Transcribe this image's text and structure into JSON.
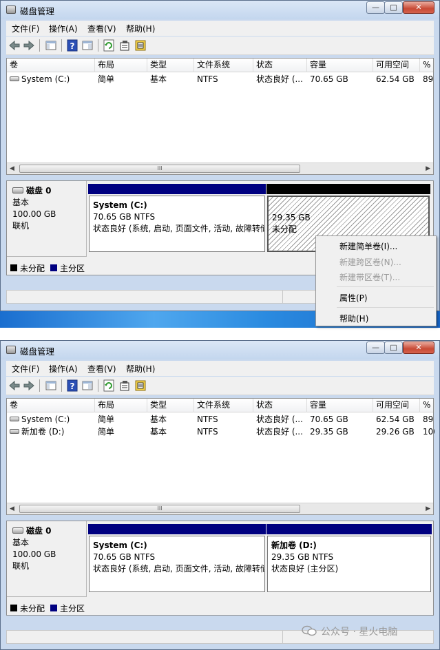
{
  "title": "磁盘管理",
  "window_controls": {
    "minimize": "—",
    "maximize": "□",
    "close": "✕"
  },
  "menu": [
    "文件(F)",
    "操作(A)",
    "查看(V)",
    "帮助(H)"
  ],
  "toolbar_icons": [
    "back-arrow-icon",
    "forward-arrow-icon",
    "console-tree-icon",
    "help-icon",
    "action-pane-icon",
    "refresh-icon",
    "properties-icon",
    "disk-settings-icon"
  ],
  "columns": [
    "卷",
    "布局",
    "类型",
    "文件系统",
    "状态",
    "容量",
    "可用空间",
    "%"
  ],
  "volumes_before": [
    {
      "name": "System (C:)",
      "layout": "简单",
      "type": "基本",
      "fs": "NTFS",
      "status": "状态良好 (...",
      "capacity": "70.65 GB",
      "free": "62.54 GB",
      "pct": "89"
    }
  ],
  "volumes_after": [
    {
      "name": "System (C:)",
      "layout": "简单",
      "type": "基本",
      "fs": "NTFS",
      "status": "状态良好 (...",
      "capacity": "70.65 GB",
      "free": "62.54 GB",
      "pct": "89"
    },
    {
      "name": "新加卷 (D:)",
      "layout": "简单",
      "type": "基本",
      "fs": "NTFS",
      "status": "状态良好 (...",
      "capacity": "29.35 GB",
      "free": "29.26 GB",
      "pct": "100"
    }
  ],
  "disk": {
    "name": "磁盘 0",
    "type": "基本",
    "size": "100.00 GB",
    "state": "联机"
  },
  "partition_c": {
    "name": "System  (C:)",
    "size": "70.65 GB NTFS",
    "status": "状态良好 (系统, 启动, 页面文件, 活动, 故障转储"
  },
  "partition_unalloc": {
    "size": "29.35 GB",
    "status": "未分配"
  },
  "partition_d": {
    "name": "新加卷  (D:)",
    "size": "29.35 GB NTFS",
    "status": "状态良好 (主分区)"
  },
  "legend": {
    "unallocated": "未分配",
    "primary": "主分区"
  },
  "colors": {
    "primary": "#000080",
    "unallocated": "#000000",
    "titlebar": "#c9d9ee"
  },
  "context_menu": [
    {
      "label": "新建简单卷(I)...",
      "enabled": true
    },
    {
      "label": "新建跨区卷(N)...",
      "enabled": false
    },
    {
      "label": "新建带区卷(T)...",
      "enabled": false
    },
    {
      "label": "属性(P)",
      "enabled": true
    },
    {
      "label": "帮助(H)",
      "enabled": true
    }
  ],
  "scroll_grip": "III",
  "watermark": "公众号 · 星火电脑"
}
